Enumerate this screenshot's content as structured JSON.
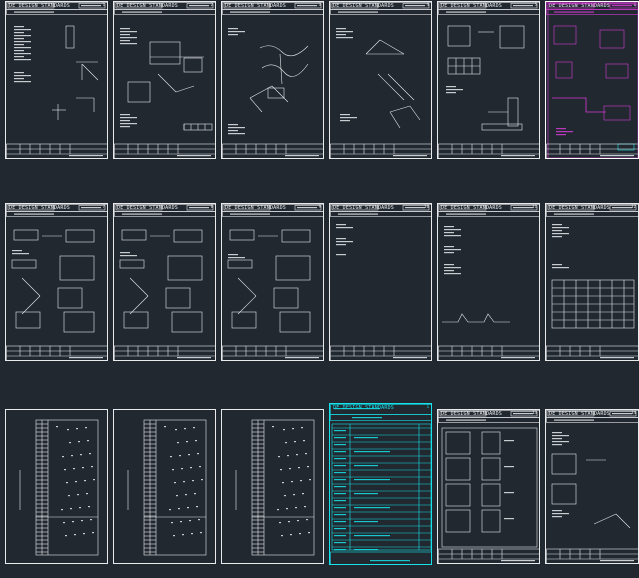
{
  "colors": {
    "background": "#212830",
    "line": "#e8eaec",
    "cyan": "#16e2ea",
    "magenta": "#d63bd6"
  },
  "sheets": [
    {
      "id": "r1c1",
      "title": "DE DESIGN STANDARDS",
      "page": "1"
    },
    {
      "id": "r1c2",
      "title": "DE DESIGN STANDARDS",
      "page": "2"
    },
    {
      "id": "r1c3",
      "title": "DE DESIGN STANDARDS",
      "page": "3"
    },
    {
      "id": "r1c4",
      "title": "DE DESIGN STANDARDS",
      "page": "4"
    },
    {
      "id": "r1c5",
      "title": "DE DESIGN STANDARDS",
      "page": "5"
    },
    {
      "id": "r1c6",
      "title": "DE DESIGN STANDARDS",
      "page": "6"
    },
    {
      "id": "r2c1",
      "title": "DE DESIGN STANDARDS",
      "page": "7"
    },
    {
      "id": "r2c2",
      "title": "DE DESIGN STANDARDS",
      "page": "8"
    },
    {
      "id": "r2c3",
      "title": "DE DESIGN STANDARDS",
      "page": "9"
    },
    {
      "id": "r2c4",
      "title": "DE DESIGN STANDARDS",
      "page": "10"
    },
    {
      "id": "r2c5",
      "title": "DE DESIGN STANDARDS",
      "page": "11"
    },
    {
      "id": "r2c6",
      "title": "DE DESIGN STANDARDS",
      "page": "12"
    },
    {
      "id": "r3c1",
      "title": "",
      "page": ""
    },
    {
      "id": "r3c2",
      "title": "",
      "page": ""
    },
    {
      "id": "r3c3",
      "title": "",
      "page": ""
    },
    {
      "id": "r3c4",
      "title": "DE DESIGN STANDARDS",
      "page": "1"
    },
    {
      "id": "r3c5",
      "title": "DE DESIGN STANDARDS",
      "page": "13"
    },
    {
      "id": "r3c6",
      "title": "DE DESIGN STANDARDS",
      "page": "14"
    }
  ]
}
